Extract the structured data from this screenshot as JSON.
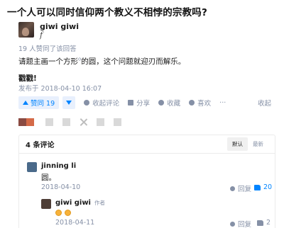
{
  "question": {
    "title": "一个人可以同时信仰两个教义不相悖的宗教吗?"
  },
  "answer": {
    "author": {
      "name": "giwi giwi",
      "signature": "f"
    },
    "upvote_note": "19 人赞同了该回答",
    "content": {
      "text_before": "请题主画一个方形",
      "text_sup": "o",
      "text_after": "的圆，这个问题就迎刃而解乐。",
      "ending": "戳戳!"
    },
    "published": "发布于 2018-04-10 16:07"
  },
  "actions": {
    "upvote_label": "赞同 19",
    "comment_label": "收起评论",
    "share_label": "分享",
    "favorite_label": "收藏",
    "like_label": "喜欢",
    "more_label": "···",
    "collapse_label": "收起"
  },
  "comments": {
    "count_label": "4 条评论",
    "sort_options": [
      "默认",
      "最新"
    ],
    "items": [
      {
        "author": "jinning li",
        "text": "圆。",
        "date": "2018-04-10",
        "reply_label": "回复",
        "likes": "20",
        "avatar_color": "#4a6a8a"
      },
      {
        "author": "giwi giwi",
        "tag": "作者",
        "text": "",
        "date": "2018-04-11",
        "reply_label": "回复",
        "likes": "2",
        "avatar_color": "#4e3e36"
      }
    ]
  },
  "colors": {
    "accent": "#0084ff",
    "muted": "#8590a6",
    "text": "#1a1a1a"
  }
}
